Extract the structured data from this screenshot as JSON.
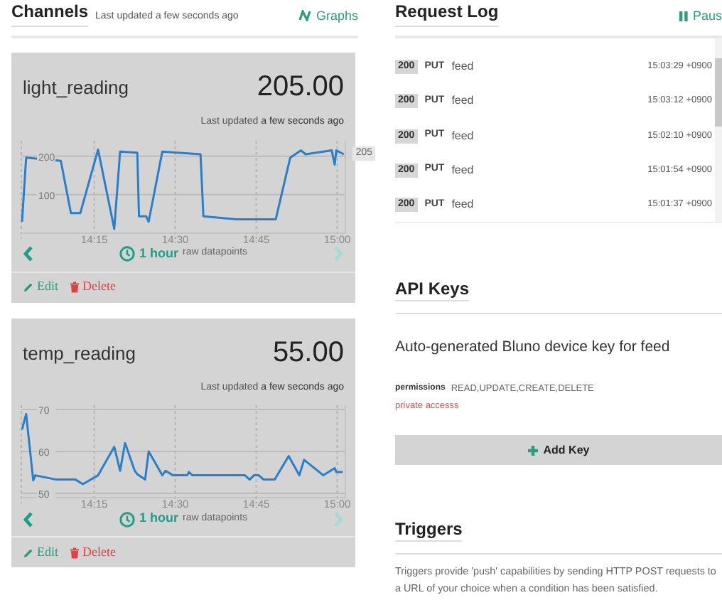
{
  "channels_panel": {
    "title": "Channels",
    "updated": "Last updated a few seconds ago",
    "graphs_link": "Graphs"
  },
  "channels": [
    {
      "name": "light_reading",
      "value": "205.00",
      "updated_prefix": "Last updated",
      "updated_rest": "a few seconds ago",
      "value_tag": "205",
      "range": "1 hour",
      "range_note": "raw datapoints",
      "older_disabled": false,
      "newer_disabled": true,
      "edit": "Edit",
      "delete": "Delete",
      "chart_data": {
        "type": "line",
        "x": [
          14.027,
          14.04,
          14.147,
          14.178,
          14.207,
          14.262,
          14.312,
          14.33,
          14.383,
          14.388,
          14.41,
          14.418,
          14.46,
          14.578,
          14.587,
          14.688,
          14.81,
          14.855,
          14.888,
          14.902,
          14.983,
          14.992,
          14.997,
          15.02
        ],
        "series": [
          {
            "color": "#2a7fc9",
            "values": [
              30,
              196,
              188,
              52,
              52,
              217,
              11,
              212,
              209,
              44,
              44,
              30,
              212,
              205,
              44,
              36,
              36,
              196,
              215,
              205,
              215,
              178,
              215,
              205
            ]
          }
        ],
        "grid": true,
        "xlim": [
          14.025,
          15.025
        ],
        "ylim": [
          0,
          240
        ],
        "xticks": [
          {
            "value": 14.25,
            "label": "14:15"
          },
          {
            "value": 14.5,
            "label": "14:30"
          },
          {
            "value": 14.75,
            "label": "14:45"
          },
          {
            "value": 15,
            "label": "15:00"
          }
        ],
        "yticks": [
          100,
          200
        ]
      }
    },
    {
      "name": "temp_reading",
      "value": "55.00",
      "updated_prefix": "Last updated",
      "updated_rest": "a few seconds ago",
      "range": "1 hour",
      "range_note": "raw datapoints",
      "older_disabled": false,
      "newer_disabled": true,
      "edit": "Edit",
      "delete": "Delete",
      "chart_data": {
        "type": "line",
        "x": [
          14.027,
          14.04,
          14.062,
          14.068,
          14.133,
          14.192,
          14.215,
          14.262,
          14.312,
          14.33,
          14.345,
          14.375,
          14.383,
          14.407,
          14.418,
          14.46,
          14.47,
          14.493,
          14.537,
          14.542,
          14.553,
          14.715,
          14.73,
          14.743,
          14.758,
          14.773,
          14.807,
          14.85,
          14.883,
          14.898,
          14.957,
          14.992,
          14.997,
          15.017
        ],
        "series": [
          {
            "color": "#2a7fc9",
            "values": [
              65.2,
              68.9,
              53.1,
              54.3,
              53.3,
              53.3,
              52.2,
              54.3,
              61.1,
              55.4,
              62.0,
              55.4,
              54.6,
              53.3,
              60.0,
              54.3,
              55.4,
              54.3,
              54.3,
              55.1,
              54.3,
              54.3,
              53.3,
              54.3,
              54.3,
              53.3,
              53.3,
              58.9,
              54.3,
              58.0,
              54.3,
              56.0,
              55.1,
              55.1
            ]
          }
        ],
        "grid": true,
        "xlim": [
          14.025,
          15.025
        ],
        "ylim": [
          49,
          71
        ],
        "xticks": [
          {
            "value": 14.25,
            "label": "14:15"
          },
          {
            "value": 14.5,
            "label": "14:30"
          },
          {
            "value": 14.75,
            "label": "14:45"
          },
          {
            "value": 15,
            "label": "15:00"
          }
        ],
        "yticks": [
          50,
          60,
          70
        ]
      }
    }
  ],
  "request_log": {
    "title": "Request Log",
    "pause": "Paus",
    "rows": [
      {
        "status": "200",
        "method": "PUT",
        "path": "feed",
        "time": "15:03:29 +0900"
      },
      {
        "status": "200",
        "method": "PUT",
        "path": "feed",
        "time": "15:03:12 +0900"
      },
      {
        "status": "200",
        "method": "PUT",
        "path": "feed",
        "time": "15:02:10 +0900"
      },
      {
        "status": "200",
        "method": "PUT",
        "path": "feed",
        "time": "15:01:54 +0900"
      },
      {
        "status": "200",
        "method": "PUT",
        "path": "feed",
        "time": "15:01:37 +0900"
      }
    ]
  },
  "api_keys": {
    "title": "API Keys",
    "description": "Auto-generated Bluno device key for feed",
    "permissions_label": "permissions",
    "permissions": "READ,UPDATE,CREATE,DELETE",
    "access": "private accesss",
    "add_button": "Add Key"
  },
  "triggers": {
    "title": "Triggers",
    "text": "Triggers provide 'push' capabilities by sending HTTP POST requests to a URL of your choice when a condition has been satisfied."
  }
}
